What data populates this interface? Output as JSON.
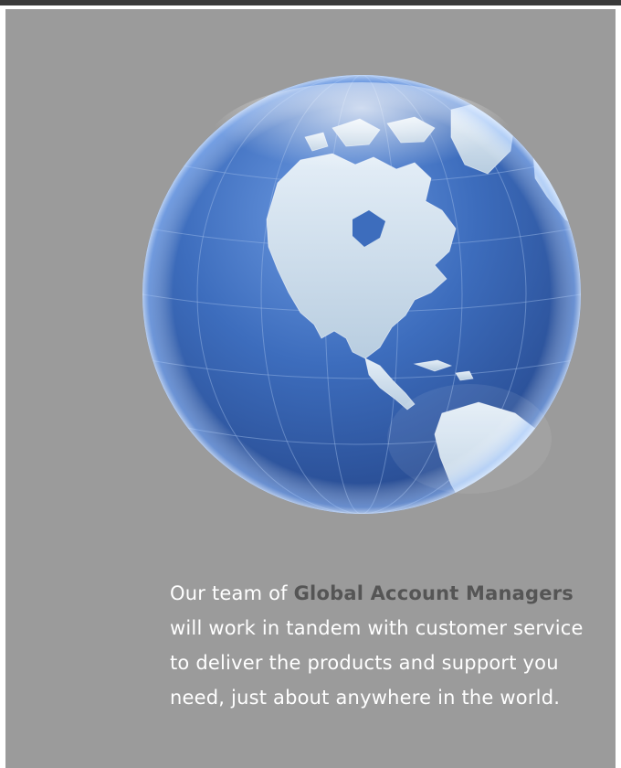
{
  "blurb": {
    "lead": "Our team of ",
    "highlight": "Global Account Managers",
    "rest": " will work in tandem with customer service to deliver the products and support you need, just about anywhere in the world."
  },
  "colors": {
    "panel_background": "#9b9b9b",
    "body_text": "#ffffff",
    "highlight_text": "#555555",
    "ocean": "#2f5fae",
    "land": "#c9d9e8"
  },
  "icons": {
    "globe": "globe-north-america-icon"
  }
}
